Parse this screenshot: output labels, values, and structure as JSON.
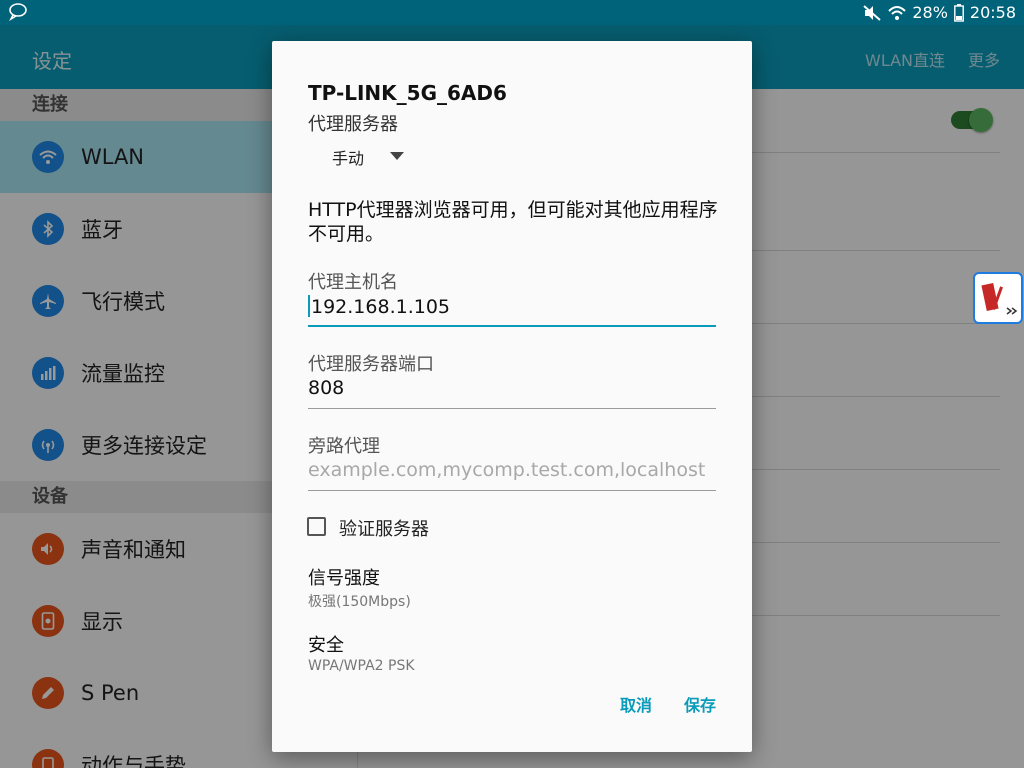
{
  "status_bar": {
    "battery": "28%",
    "time": "20:58"
  },
  "app_bar": {
    "title": "设定",
    "action_wifi_direct": "WLAN直连",
    "action_more": "更多"
  },
  "sidebar": {
    "sections": [
      {
        "header": "连接",
        "items": [
          {
            "label": "WLAN",
            "icon": "wifi-icon",
            "active": true
          },
          {
            "label": "蓝牙",
            "icon": "bluetooth-icon"
          },
          {
            "label": "飞行模式",
            "icon": "airplane-icon"
          },
          {
            "label": "流量监控",
            "icon": "data-usage-icon"
          },
          {
            "label": "更多连接设定",
            "icon": "more-connections-icon"
          }
        ]
      },
      {
        "header": "设备",
        "items": [
          {
            "label": "声音和通知",
            "icon": "sound-icon"
          },
          {
            "label": "显示",
            "icon": "display-icon"
          },
          {
            "label": "S Pen",
            "icon": "s-pen-icon"
          },
          {
            "label": "动作与手势",
            "icon": "motions-icon"
          }
        ]
      }
    ]
  },
  "wlan_toggle": {
    "on": true
  },
  "dialog": {
    "network_name": "TP-LINK_5G_6AD6",
    "proxy_label": "代理服务器",
    "proxy_mode": "手动",
    "warning": "HTTP代理器浏览器可用，但可能对其他应用程序不可用。",
    "hostname_label": "代理主机名",
    "hostname_value": "192.168.1.105",
    "port_label": "代理服务器端口",
    "port_value": "808",
    "bypass_label": "旁路代理",
    "bypass_placeholder": "example.com,mycomp.test.com,localhost",
    "auth_checkbox_label": "验证服务器",
    "auth_checked": false,
    "signal_label": "信号强度",
    "signal_value": "极强(150Mbps)",
    "security_label": "安全",
    "security_value": "WPA/WPA2 PSK",
    "cancel_label": "取消",
    "save_label": "保存"
  },
  "colors": {
    "accent": "#0b9bba",
    "app_bar": "#0b9bba",
    "status_bar": "#00637a",
    "active_item": "#a8e4f2",
    "icon_blue": "#1e88e5",
    "icon_orange": "#e8561b"
  }
}
